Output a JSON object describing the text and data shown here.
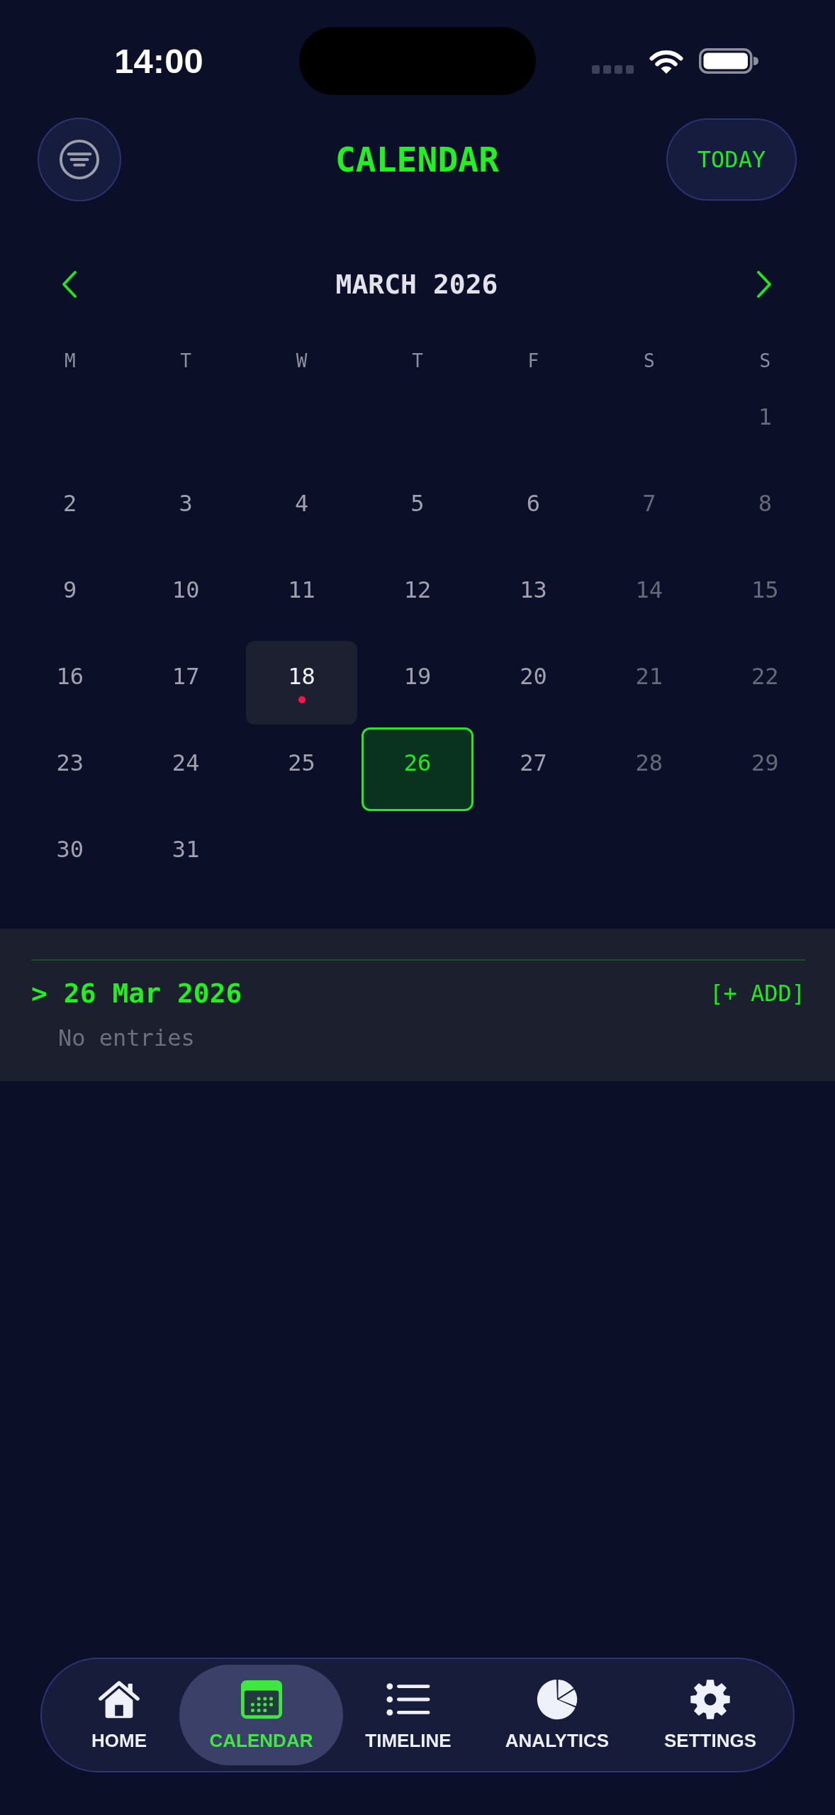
{
  "status_bar": {
    "time": "14:00"
  },
  "header": {
    "title": "CALENDAR",
    "today_button": "TODAY"
  },
  "month_nav": {
    "title": "MARCH 2026"
  },
  "weekdays": [
    "M",
    "T",
    "W",
    "T",
    "F",
    "S",
    "S"
  ],
  "weeks": [
    [
      {
        "label": "1",
        "weekend": true,
        "today": false,
        "selected": false,
        "has_entries": false
      }
    ],
    [
      {
        "label": "2",
        "weekend": false,
        "today": false,
        "selected": false,
        "has_entries": false
      },
      {
        "label": "3",
        "weekend": false,
        "today": false,
        "selected": false,
        "has_entries": false
      },
      {
        "label": "4",
        "weekend": false,
        "today": false,
        "selected": false,
        "has_entries": false
      },
      {
        "label": "5",
        "weekend": false,
        "today": false,
        "selected": false,
        "has_entries": false
      },
      {
        "label": "6",
        "weekend": false,
        "today": false,
        "selected": false,
        "has_entries": false
      },
      {
        "label": "7",
        "weekend": true,
        "today": false,
        "selected": false,
        "has_entries": false
      },
      {
        "label": "8",
        "weekend": true,
        "today": false,
        "selected": false,
        "has_entries": false
      }
    ],
    [
      {
        "label": "9",
        "weekend": false,
        "today": false,
        "selected": false,
        "has_entries": false
      },
      {
        "label": "10",
        "weekend": false,
        "today": false,
        "selected": false,
        "has_entries": false
      },
      {
        "label": "11",
        "weekend": false,
        "today": false,
        "selected": false,
        "has_entries": false
      },
      {
        "label": "12",
        "weekend": false,
        "today": false,
        "selected": false,
        "has_entries": false
      },
      {
        "label": "13",
        "weekend": false,
        "today": false,
        "selected": false,
        "has_entries": false
      },
      {
        "label": "14",
        "weekend": true,
        "today": false,
        "selected": false,
        "has_entries": false
      },
      {
        "label": "15",
        "weekend": true,
        "today": false,
        "selected": false,
        "has_entries": false
      }
    ],
    [
      {
        "label": "16",
        "weekend": false,
        "today": false,
        "selected": false,
        "has_entries": false
      },
      {
        "label": "17",
        "weekend": false,
        "today": false,
        "selected": false,
        "has_entries": false
      },
      {
        "label": "18",
        "weekend": false,
        "today": true,
        "selected": false,
        "has_entries": true
      },
      {
        "label": "19",
        "weekend": false,
        "today": false,
        "selected": false,
        "has_entries": false
      },
      {
        "label": "20",
        "weekend": false,
        "today": false,
        "selected": false,
        "has_entries": false
      },
      {
        "label": "21",
        "weekend": true,
        "today": false,
        "selected": false,
        "has_entries": false
      },
      {
        "label": "22",
        "weekend": true,
        "today": false,
        "selected": false,
        "has_entries": false
      }
    ],
    [
      {
        "label": "23",
        "weekend": false,
        "today": false,
        "selected": false,
        "has_entries": false
      },
      {
        "label": "24",
        "weekend": false,
        "today": false,
        "selected": false,
        "has_entries": false
      },
      {
        "label": "25",
        "weekend": false,
        "today": false,
        "selected": false,
        "has_entries": false
      },
      {
        "label": "26",
        "weekend": false,
        "today": false,
        "selected": true,
        "has_entries": false
      },
      {
        "label": "27",
        "weekend": false,
        "today": false,
        "selected": false,
        "has_entries": false
      },
      {
        "label": "28",
        "weekend": true,
        "today": false,
        "selected": false,
        "has_entries": false
      },
      {
        "label": "29",
        "weekend": true,
        "today": false,
        "selected": false,
        "has_entries": false
      }
    ],
    [
      {
        "label": "30",
        "weekend": false,
        "today": false,
        "selected": false,
        "has_entries": false
      },
      {
        "label": "31",
        "weekend": false,
        "today": false,
        "selected": false,
        "has_entries": false
      }
    ]
  ],
  "day_panel": {
    "title": "> 26 Mar 2026",
    "add_button": "[+ ADD]",
    "empty_text": "No entries"
  },
  "tab_bar": [
    {
      "label": "HOME",
      "selected": false
    },
    {
      "label": "CALENDAR",
      "selected": true
    },
    {
      "label": "TIMELINE",
      "selected": false
    },
    {
      "label": "ANALYTICS",
      "selected": false
    },
    {
      "label": "SETTINGS",
      "selected": false
    }
  ]
}
